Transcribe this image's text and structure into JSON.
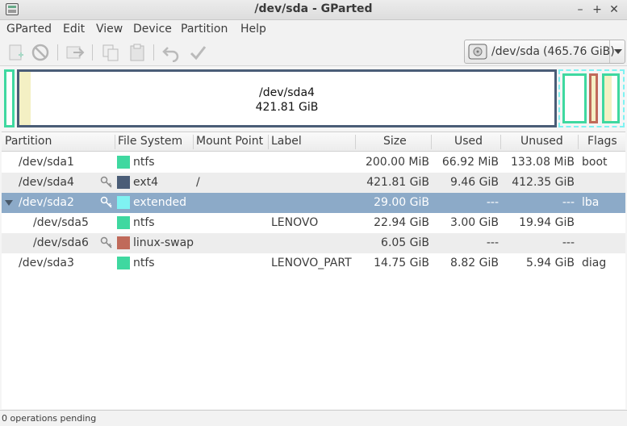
{
  "window": {
    "title": "/dev/sda - GParted"
  },
  "menu": [
    "GParted",
    "Edit",
    "View",
    "Device",
    "Partition",
    "Help"
  ],
  "device": {
    "name": "/dev/sda",
    "size": "(465.76 GiB)"
  },
  "diskmap": {
    "main_label": "/dev/sda4",
    "main_size": "421.81 GiB"
  },
  "columns": [
    "Partition",
    "File System",
    "Mount Point",
    "Label",
    "Size",
    "Used",
    "Unused",
    "Flags"
  ],
  "rows": [
    {
      "partition": "/dev/sda1",
      "fs": "ntfs",
      "fs_color": "#3fd8a0",
      "mount": "",
      "label": "",
      "size": "200.00 MiB",
      "used": "66.92 MiB",
      "unused": "133.08 MiB",
      "flags": "boot",
      "locked": false
    },
    {
      "partition": "/dev/sda4",
      "fs": "ext4",
      "fs_color": "#4a5d77",
      "mount": "/",
      "label": "",
      "size": "421.81 GiB",
      "used": "9.46 GiB",
      "unused": "412.35 GiB",
      "flags": "",
      "locked": true
    },
    {
      "partition": "/dev/sda2",
      "fs": "extended",
      "fs_color": "#7ff2f2",
      "mount": "",
      "label": "",
      "size": "29.00 GiB",
      "used": "---",
      "unused": "---",
      "flags": "lba",
      "locked": true
    },
    {
      "partition": "/dev/sda5",
      "fs": "ntfs",
      "fs_color": "#3fd8a0",
      "mount": "",
      "label": "LENOVO",
      "size": "22.94 GiB",
      "used": "3.00 GiB",
      "unused": "19.94 GiB",
      "flags": "",
      "locked": false
    },
    {
      "partition": "/dev/sda6",
      "fs": "linux-swap",
      "fs_color": "#c06a5a",
      "mount": "",
      "label": "",
      "size": "6.05 GiB",
      "used": "---",
      "unused": "---",
      "flags": "",
      "locked": true
    },
    {
      "partition": "/dev/sda3",
      "fs": "ntfs",
      "fs_color": "#3fd8a0",
      "mount": "",
      "label": "LENOVO_PART",
      "size": "14.75 GiB",
      "used": "8.82 GiB",
      "unused": "5.94 GiB",
      "flags": "diag",
      "locked": false
    }
  ],
  "status": {
    "text": "0 operations pending"
  }
}
